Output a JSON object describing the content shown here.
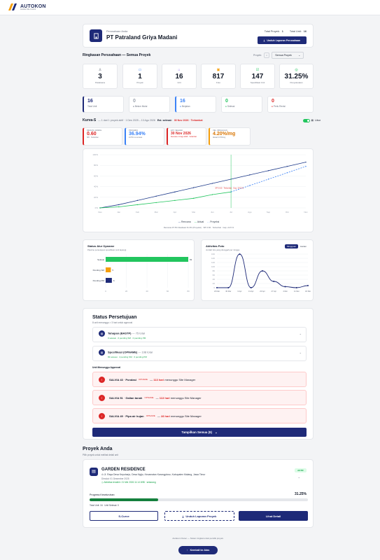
{
  "brand": {
    "name": "AUTOKON",
    "tagline": "Autokon Site Control"
  },
  "company": {
    "label": "Perusahaan Anda",
    "name": "PT Patraland Griya Madani",
    "total_proyek_label": "Total Proyek:",
    "total_proyek": "1",
    "total_unit_label": "Total Unit:",
    "total_unit": "16",
    "download_label": "Unduh Laporan Perusahaan"
  },
  "summary": {
    "title": "Ringkasan Perusahaan — Semua Proyek",
    "filter_label": "Proyek:",
    "filter_value": "Semua Proyek"
  },
  "stats": [
    {
      "value": "3",
      "label": "Pelaksana"
    },
    {
      "value": "1",
      "label": "Proyek"
    },
    {
      "value": "16",
      "label": "Unit"
    },
    {
      "value": "817",
      "label": "Foto"
    },
    {
      "value": "147",
      "label": "Spesifikasi Unit"
    },
    {
      "value": "31.25%",
      "label": "Penyelesaian"
    }
  ],
  "counts": [
    {
      "value": "16",
      "label": "Total Unit"
    },
    {
      "value": "0",
      "label": "Belum Mulai"
    },
    {
      "value": "16",
      "label": "Berjalan"
    },
    {
      "value": "0",
      "label": "Selesai"
    },
    {
      "value": "0",
      "label": "Perlu Revisi"
    }
  ],
  "kurva": {
    "title": "Kurva-S",
    "sub": "— 1 dari 1 proyek aktif · 1 Des 2025 – 13 Agu 2026",
    "est_label": "Est. selesai:",
    "est_value": "30 Nov 2026 · Terlambat",
    "toggle": "Libur"
  },
  "kpis": [
    {
      "h": "Deviasi Jadwal",
      "v": "0.60",
      "s": "SPI · Terlambat"
    },
    {
      "h": "Progres",
      "v": "36.94%",
      "s": "24.5% vs rencana"
    },
    {
      "h": "Est. Selesai",
      "v": "30 Nov 2026",
      "s": "Rencana: 13 Agu 2026 · Terlambat"
    },
    {
      "h": "Vel. Mingguan",
      "v": "4.20%/mg",
      "s": "Aktual 3.37%/mg"
    }
  ],
  "chart_data": {
    "type": "line",
    "x": [
      "Des",
      "Jan",
      "Feb",
      "Mar",
      "Apr",
      "Mei",
      "Jun",
      "Jul",
      "Agu",
      "Sep",
      "Okt",
      "Nov"
    ],
    "series": [
      {
        "name": "Rencana",
        "values": [
          0,
          6,
          14,
          22,
          30,
          38,
          46,
          54,
          62,
          70,
          78,
          86
        ]
      },
      {
        "name": "Aktual",
        "values": [
          0,
          2,
          6,
          10,
          14,
          18,
          25,
          30,
          null,
          null,
          null,
          null
        ]
      },
      {
        "name": "Proyeksi",
        "values": [
          null,
          null,
          null,
          null,
          null,
          null,
          null,
          30,
          42,
          54,
          66,
          78
        ]
      }
    ],
    "ylim": [
      0,
      100
    ],
    "annotation": "SPI 0.60 · Terlambat · Gap -24.5 %",
    "legend": [
      "Rencana",
      "Aktual",
      "Proyeksi"
    ],
    "footnote": "Rencana 97.5% Realisasi 61.3% (Proyeksi) · SPI 0.60 · Terlambat · Gap -24.5 %"
  },
  "opname": {
    "title": "Status Alur Opname",
    "sub": "Pipeline persetujuan spesifikasi (unit lapang)",
    "bars": [
      {
        "label": "Selesai",
        "value": 83,
        "color": "#22c55e"
      },
      {
        "label": "Pending SM",
        "value": 5,
        "color": "#f59e0b"
      },
      {
        "label": "Pending PM",
        "value": 6,
        "color": "#1e2a78"
      }
    ],
    "ticks": [
      "0",
      "20",
      "40",
      "60",
      "80"
    ]
  },
  "foto": {
    "title": "Aktivitas Foto",
    "sub": "Jumlah foto yang diunggah per minggu",
    "tab1": "Mingguan",
    "tab2": "Harian",
    "ticks": [
      "160",
      "140",
      "120",
      "100",
      "80",
      "60",
      "40",
      "20",
      "0"
    ],
    "xlabels": [
      "23 Mar",
      "30 Mar",
      "6 Apr",
      "13 Apr",
      "20 Apr",
      "27 Apr",
      "4 Mei",
      "11 Mei",
      "18 Mei"
    ],
    "values": [
      0,
      0,
      160,
      0,
      80,
      30,
      5,
      0,
      10
    ]
  },
  "approval": {
    "title": "Status Persetujuan",
    "sub": "8 unit menunggu > 3 hari untuk approval",
    "tahapan": "Tahapan (BASTP)",
    "tahapan_total": "— 75 total",
    "tahapan_detail": "0 selesai · 0 pending SM · 0 pending PM",
    "spek": "Spesifikasi (OPNAME)",
    "spek_total": "— 108 total",
    "spek_detail": "83 selesai · 4 pending SM · 6 pending PM",
    "waiting_title": "Unit Menunggu Approval",
    "items": [
      {
        "unit": "SALVIA 43",
        "task": "Pondasi",
        "type": "OPNAME",
        "days": "113 hari",
        "who": "menunggu Site Manager"
      },
      {
        "unit": "SALVIA 51",
        "task": "Galian tanah",
        "type": "OPNAME",
        "days": "113 hari",
        "who": "menunggu Site Manager"
      },
      {
        "unit": "SALVIA 49",
        "task": "Pipa air hujan",
        "type": "OPNAME",
        "days": "28 hari",
        "who": "menunggu Site Manager"
      }
    ],
    "show_all": "Tampilkan Semua (9)"
  },
  "projects": {
    "title": "Proyek Anda",
    "sub": "Pilih proyek untuk melihat detail unit",
    "name": "GARDEN RESIDENCE",
    "status": "AKTIF",
    "address": "Jl. Raya Desa Kepuharjo, Desa Ngijo, Kecamatan Karangploso, Kabupaten Malang, Jawa Timur",
    "date": "Dimulai: 01 Desember 2025",
    "last": "Aktivitas terakhir: 21 Mei 2026 11:14 WIB · sekarang",
    "progress_label": "Progress Keseluruhan",
    "progress": "31.25%",
    "progress_value": 0.3125,
    "total_unit": "Total Unit: 16",
    "done_unit": "Unit Selesai: 0",
    "btn1": "S-Curve",
    "btn2": "Unduh Laporan Proyek",
    "btn3": "Lihat Detail"
  },
  "footer": "Autokon Owner — Sistem tingkat untuk pemilik proyek.",
  "back_top": "Kembali ke Atas"
}
